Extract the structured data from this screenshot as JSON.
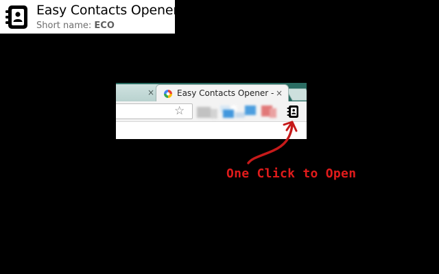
{
  "extension": {
    "name": "Easy Contacts Opener",
    "short_name_label": "Short name: ",
    "short_name_value": "ECO"
  },
  "browser": {
    "inactive_tab": {
      "close_glyph": "×"
    },
    "active_tab": {
      "title": "Easy Contacts Opener -",
      "close_glyph": "×"
    },
    "toolbar": {
      "bookmark_glyph": "☆"
    }
  },
  "annotation": {
    "text": "One Click to Open",
    "color": "#e01b1b"
  },
  "colors": {
    "background": "#000000",
    "tabstrip": "#2b6d63",
    "accent_red": "#e01b1b"
  },
  "icons": {
    "brand": "address-book-icon",
    "favicon": "google-contacts-favicon",
    "extension_button": "address-book-icon",
    "bookmark": "star-icon"
  }
}
